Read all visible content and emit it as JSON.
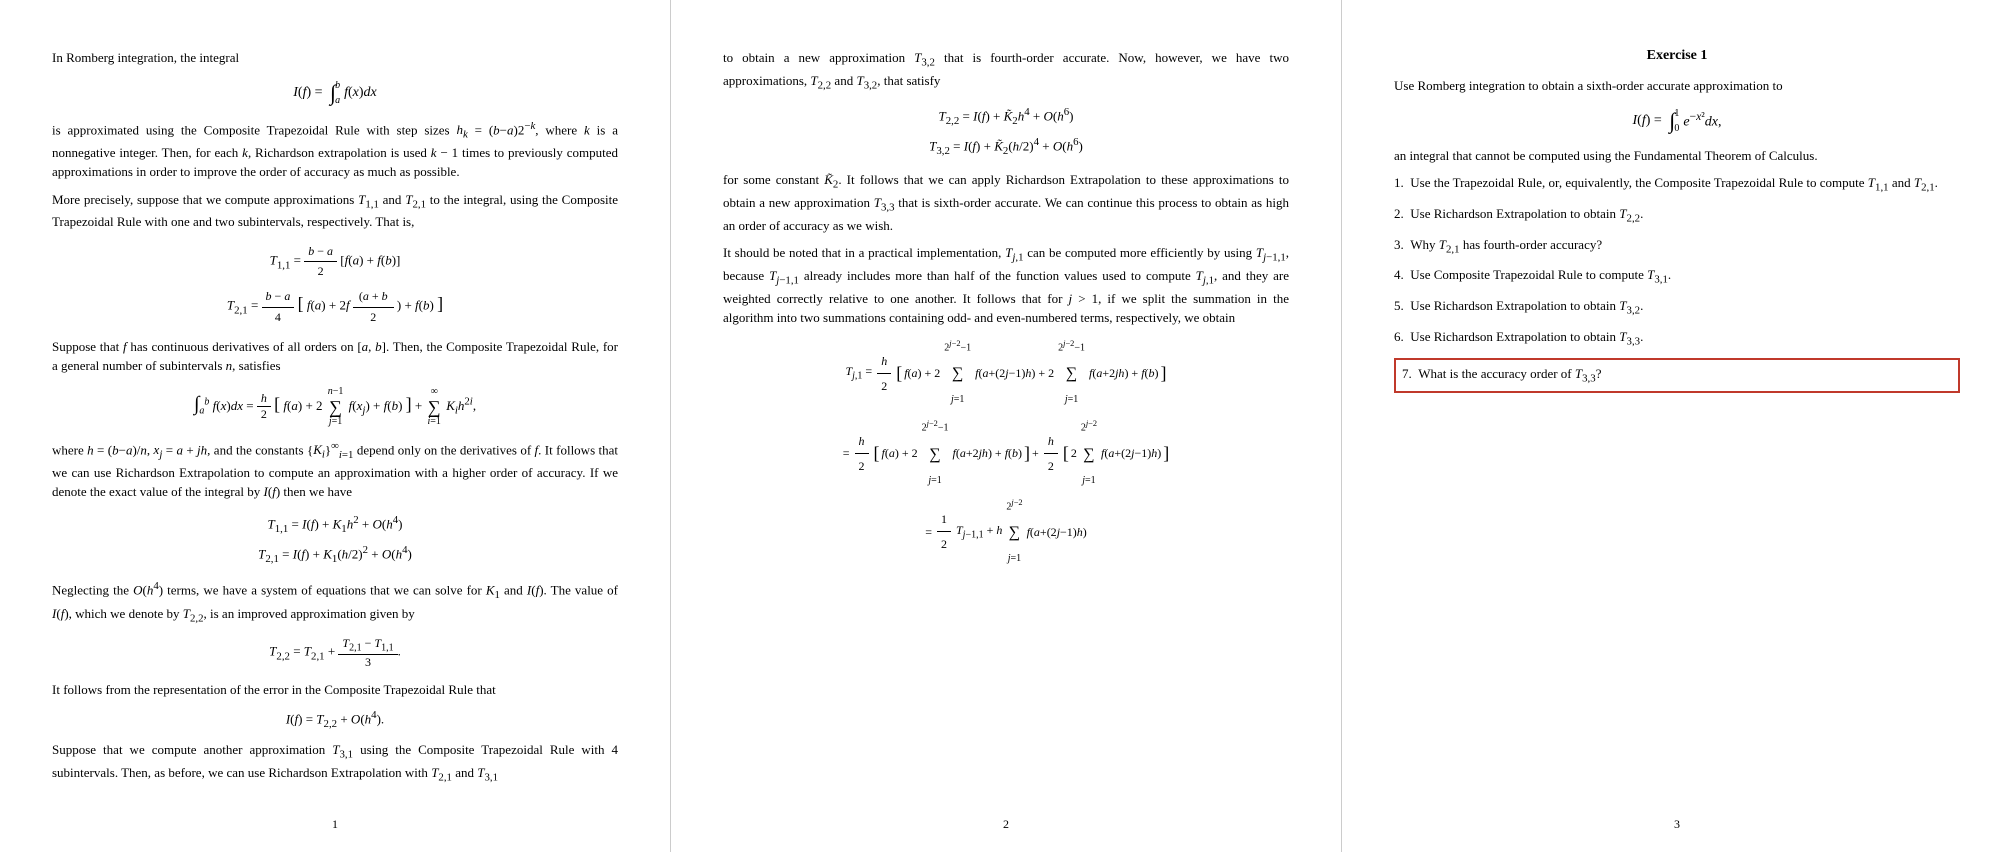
{
  "page1": {
    "number": "1",
    "paragraphs": [
      "In Romberg integration, the integral",
      "is approximated using the Composite Trapezoidal Rule with step sizes h_k = (b−a)2^{−k}, where k is a nonnegative integer. Then, for each k, Richardson extrapolation is used k−1 times to previously computed approximations in order to improve the order of accuracy as much as possible.",
      "More precisely, suppose that we compute approximations T_{1,1} and T_{2,1} to the integral, using the Composite Trapezoidal Rule with one and two subintervals, respectively. That is,",
      "Suppose that f has continuous derivatives of all orders on [a, b]. Then, the Composite Trapezoidal Rule, for a general number of subintervals n, satisfies",
      "where h = (b−a)/n, x_j = a + jh, and the constants {K_i}^∞_{i=1} depend only on the derivatives of f. It follows that we can use Richardson Extrapolation to compute an approximation with a higher order of accuracy. If we denote the exact value of the integral by I(f) then we have",
      "Neglecting the O(h^4) terms, we have a system of equations that we can solve for K_1 and I(f). The value of I(f), which we denote by T_{2,2}, is an improved approximation given by",
      "It follows from the representation of the error in the Composite Trapezoidal Rule that",
      "Suppose that we compute another approximation T_{3,1} using the Composite Trapezoidal Rule with 4 subintervals. Then, as before, we can use Richardson Extrapolation with T_{2,1} and T_{3,1}"
    ]
  },
  "page2": {
    "number": "2",
    "intro": "to obtain a new approximation T_{3,2} that is fourth-order accurate. Now, however, we have two approximations, T_{2,2} and T_{3,2}, that satisfy",
    "paragraphs": [
      "for some constant K̃_2. It follows that we can apply Richardson Extrapolation to these approximations to obtain a new approximation T_{3,3} that is sixth-order accurate. We can continue this process to obtain as high an order of accuracy as we wish.",
      "It should be noted that in a practical implementation, T_{j,1} can be computed more efficiently by using T_{j−1,1}, because T_{j−1,1} already includes more than half of the function values used to compute T_{j,1}, and they are weighted correctly relative to one another. It follows that for j > 1, if we split the summation in the algorithm into two summations containing odd- and even-numbered terms, respectively, we obtain"
    ]
  },
  "page3": {
    "number": "3",
    "title": "Exercise 1",
    "intro": "Use Romberg integration to obtain a sixth-order accurate approximation to",
    "integral_text": "I(f) = ∫₀¹ e^{−x²} dx,",
    "body": "an integral that cannot be computed using the Fundamental Theorem of Calculus.",
    "items": [
      "1.  Use the Trapezoidal Rule, or, equivalently, the Composite Trapezoidal Rule to compute T_{1,1} and T_{2,1}.",
      "2.  Use Richardson Extrapolation to obtain T_{2,2}.",
      "3.  Why T_{2,1} has fourth-order accuracy?",
      "4.  Use Composite Trapezoidal Rule to compute T_{3,1}.",
      "5.  Use Richardson Extrapolation to obtain T_{3,2}.",
      "6.  Use Richardson Extrapolation to obtain T_{3,3}.",
      "7.  What is the accuracy order of T_{3,3}?"
    ]
  }
}
